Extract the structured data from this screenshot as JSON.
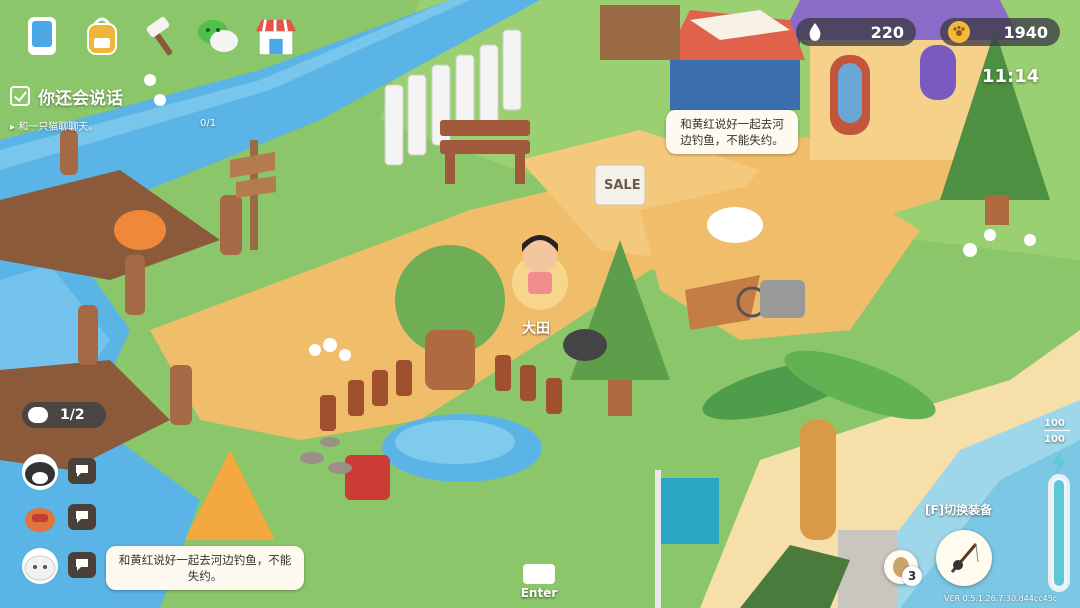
{
  "toolbar": {
    "items": [
      {
        "name": "phone",
        "color": "#4aa8e6"
      },
      {
        "name": "backpack",
        "color": "#f0b63a"
      },
      {
        "name": "hammer",
        "color": "#8a5a3b"
      },
      {
        "name": "wechat",
        "color": "#4fc04a"
      },
      {
        "name": "shop",
        "color": "#e2564c"
      }
    ]
  },
  "quest": {
    "title": "你还会说话",
    "subtitle": "和一只猫聊聊天。",
    "progress": "0/1"
  },
  "currency": {
    "water": {
      "value": "220",
      "icon": "water-drop-icon",
      "color": "#ffffff"
    },
    "coins": {
      "value": "1940",
      "icon": "coin-icon",
      "color": "#f5b93a"
    }
  },
  "clock": "11:14",
  "bubbles": {
    "top": "和黄红说好一起去河边钓鱼，不能失约。",
    "bottom": "和黄红说好一起去河边钓鱼，不能失约。"
  },
  "player_name": "大田",
  "pets": {
    "count": "1/2"
  },
  "sale_sign": "SALE",
  "enter_label": "Enter",
  "equipment": {
    "switch_label": "[F]切换装备",
    "bait_count": "3",
    "energy_max": "100",
    "energy_current": "100",
    "energy_fraction": 1.0
  },
  "version": "VER 0.5.1.26.7.30.d44cc45c",
  "colors": {
    "river": "#5ab4e6",
    "grass": "#8cc66a",
    "path": "#f0bd6a",
    "sand": "#f7dfaa",
    "energy": "#5fc8d6"
  }
}
